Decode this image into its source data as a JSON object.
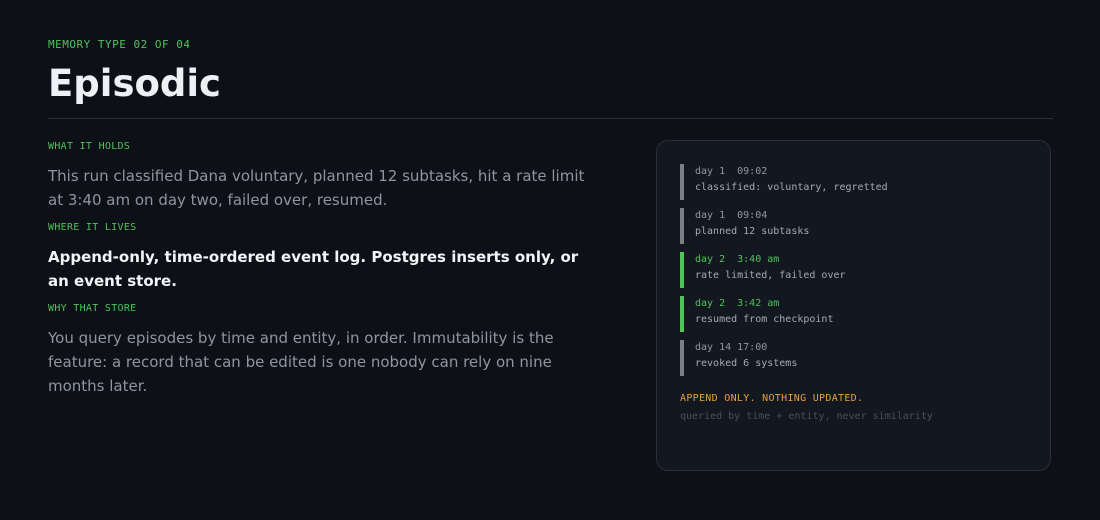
{
  "header": {
    "eyebrow": "MEMORY TYPE 02 OF 04",
    "title": "Episodic"
  },
  "sections": [
    {
      "label": "WHAT IT HOLDS",
      "text": "This run classified Dana voluntary, planned 12 subtasks, hit a rate limit at 3:40 am on day two, failed over, resumed."
    },
    {
      "label": "WHERE IT LIVES",
      "text": "Append-only, time-ordered event log. Postgres inserts only, or an event store."
    },
    {
      "label": "WHY THAT STORE",
      "text": "You query episodes by time and entity, in order. Immutability is the feature: a record that can be edited is one nobody can rely on nine months later."
    }
  ],
  "log": {
    "events": [
      {
        "when": "day 1  09:02",
        "what": "classified: voluntary, regretted",
        "highlight": false
      },
      {
        "when": "day 1  09:04",
        "what": "planned 12 subtasks",
        "highlight": false
      },
      {
        "when": "day 2  3:40 am",
        "what": "rate limited, failed over",
        "highlight": true
      },
      {
        "when": "day 2  3:42 am",
        "what": "resumed from checkpoint",
        "highlight": true
      },
      {
        "when": "day 14 17:00",
        "what": "revoked 6 systems",
        "highlight": false
      }
    ],
    "footer_title": "APPEND ONLY. NOTHING UPDATED.",
    "footer_sub": "queried by time + entity, never similarity"
  },
  "colors": {
    "background": "#0d1017",
    "accent_green": "#4fc25a",
    "accent_amber": "#e6a23c",
    "panel": "#131720"
  }
}
